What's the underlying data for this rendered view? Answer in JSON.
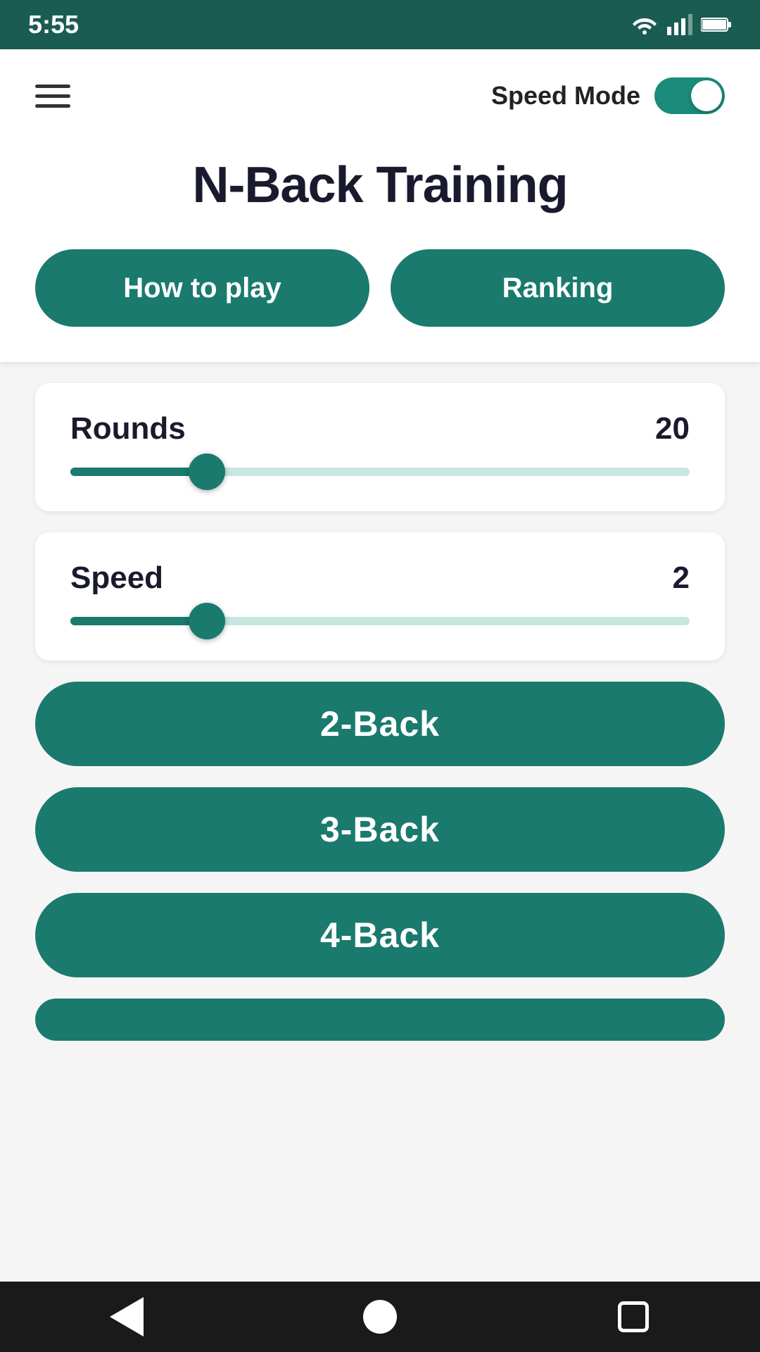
{
  "statusBar": {
    "time": "5:55",
    "wifi": "▲",
    "signal": "▲",
    "battery": "🔋"
  },
  "header": {
    "speedModeLabel": "Speed Mode",
    "toggleEnabled": true
  },
  "appTitle": "N-Back Training",
  "topButtons": {
    "howToPlay": "How to play",
    "ranking": "Ranking"
  },
  "sliders": {
    "rounds": {
      "label": "Rounds",
      "value": "20",
      "fillPercent": 22,
      "thumbPercent": 22
    },
    "speed": {
      "label": "Speed",
      "value": "2",
      "fillPercent": 22,
      "thumbPercent": 22
    }
  },
  "gameButtons": {
    "twoBack": "2-Back",
    "threeBack": "3-Back",
    "fourBack": "4-Back"
  },
  "bottomNav": {
    "back": "back",
    "home": "home",
    "recents": "recents"
  }
}
